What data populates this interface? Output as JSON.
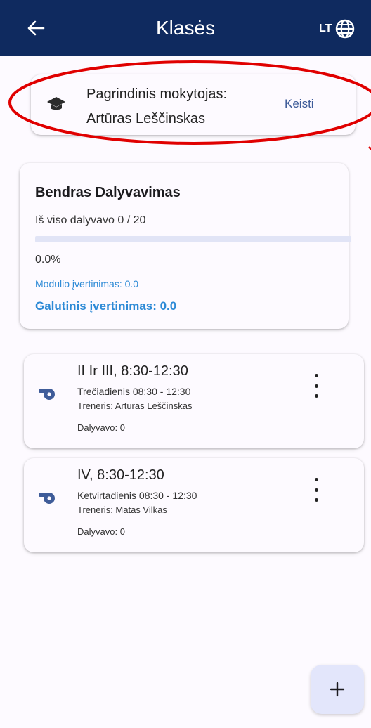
{
  "appbar": {
    "title": "Klasės",
    "language": "LT",
    "back_icon": "arrow-left-icon",
    "globe_icon": "globe-icon",
    "background": "#0f2a5f"
  },
  "teacher": {
    "label": "Pagrindinis mokytojas:",
    "name": "Artūras Leščinskas",
    "change_label": "Keisti",
    "icon": "graduation-cap-icon",
    "highlight_color": "#e00000"
  },
  "attendance": {
    "title": "Bendras Dalyvavimas",
    "total_text": "Iš viso dalyvavo 0 / 20",
    "progress": 0.0,
    "percent_text": "0.0%",
    "module_grade": "Modulio įvertinimas: 0.0",
    "final_grade": "Galutinis įvertinimas: 0.0",
    "accent": "#2d8ad6"
  },
  "groups": [
    {
      "title": "II Ir III, 8:30-12:30",
      "day": "Trečiadienis 08:30 - 12:30",
      "coach": "Treneris: Artūras Leščinskas",
      "participants": "Dalyvavo: 0",
      "icon": "whistle-icon"
    },
    {
      "title": "IV, 8:30-12:30",
      "day": "Ketvirtadienis 08:30 - 12:30",
      "coach": "Treneris: Matas Vilkas",
      "participants": "Dalyvavo: 0",
      "icon": "whistle-icon"
    }
  ],
  "fab": {
    "icon": "plus-icon",
    "label": "+"
  }
}
